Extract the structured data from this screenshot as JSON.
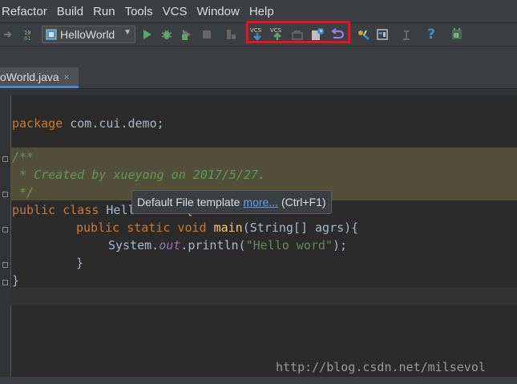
{
  "menubar": {
    "items": [
      "Refactor",
      "Build",
      "Run",
      "Tools",
      "VCS",
      "Window",
      "Help"
    ]
  },
  "toolbar": {
    "run_config": "HelloWorld",
    "vcs_update_label": "VCS",
    "vcs_commit_label": "VCS",
    "help_label": "?"
  },
  "tab": {
    "title": "oWorld.java",
    "close": "×"
  },
  "code": {
    "line1_kw": "package",
    "line1_rest": " com.cui.demo;",
    "line2": "/**",
    "line3": " * Created by xueyong on 2017/5/27.",
    "line4": " */",
    "line5_kw": "public class",
    "line5_rest": " HelloWorld {",
    "line6_kw": "public static void",
    "line6_fn": "main",
    "line6_rest": "(String[] agrs){",
    "line7_pre": "System.",
    "line7_field": "out",
    "line7_mid": ".println(",
    "line7_str": "\"Hello word\"",
    "line7_end": ");",
    "line8": "}",
    "line9": "}"
  },
  "tooltip": {
    "text": "Default File template",
    "link": "more...",
    "shortcut": "(Ctrl+F1)"
  },
  "watermark": "http://blog.csdn.net/milsevol",
  "colors": {
    "highlight_box": "#e8141b",
    "run_green": "#59a869",
    "vcs_blue": "#3d8fd1",
    "vcs_green": "#59a869",
    "revert_purple": "#9c79e5"
  }
}
